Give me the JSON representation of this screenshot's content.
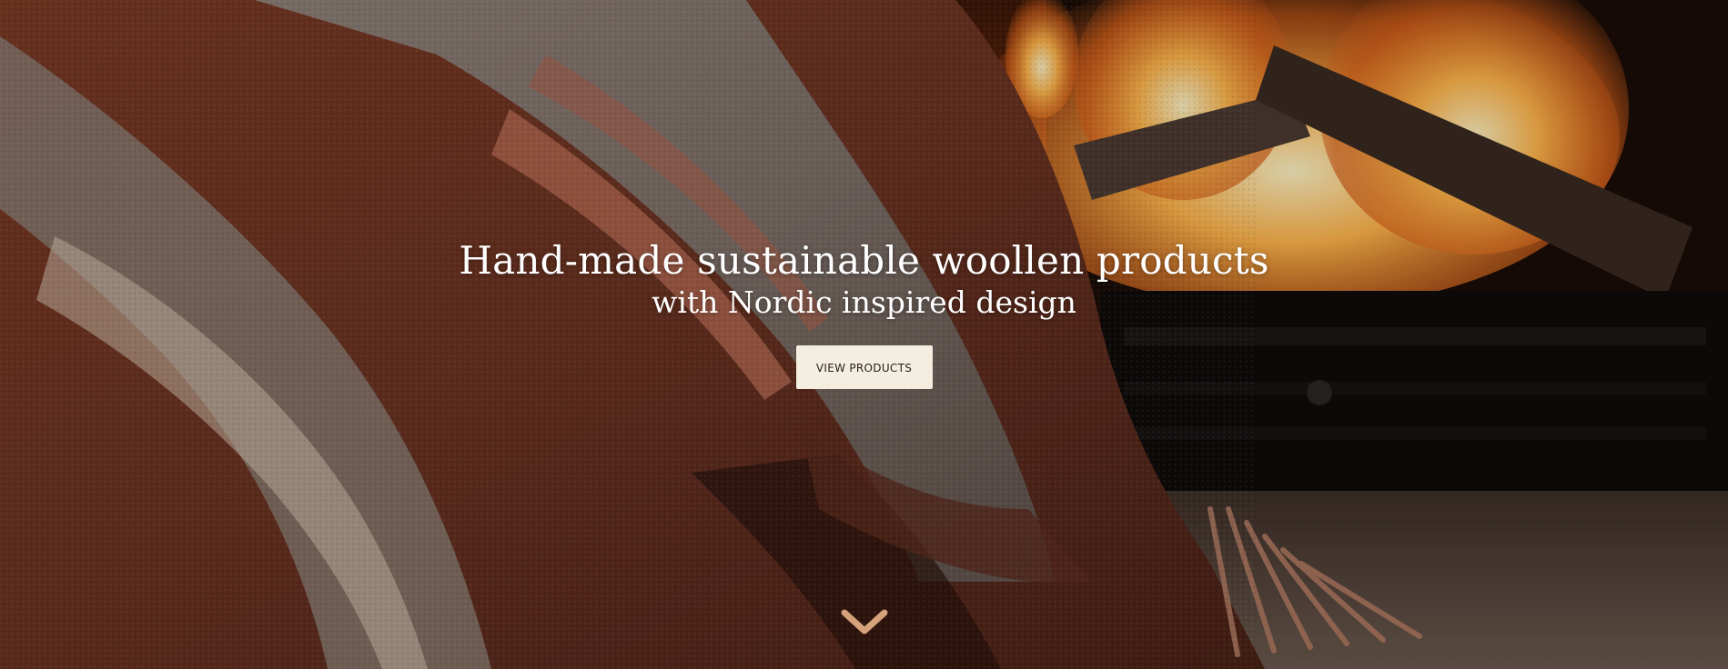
{
  "hero": {
    "title": "Hand-made sustainable woollen products",
    "subtitle": "with Nordic inspired design",
    "cta_label": "VIEW PRODUCTS",
    "background_image": "wool-blanket-by-fireplace",
    "scroll_icon": "chevron-down-icon"
  },
  "colors": {
    "button_bg": "#f4eee0",
    "button_text": "#2a1d17",
    "chevron": "#d6a27b",
    "title_text": "#ffffff"
  }
}
